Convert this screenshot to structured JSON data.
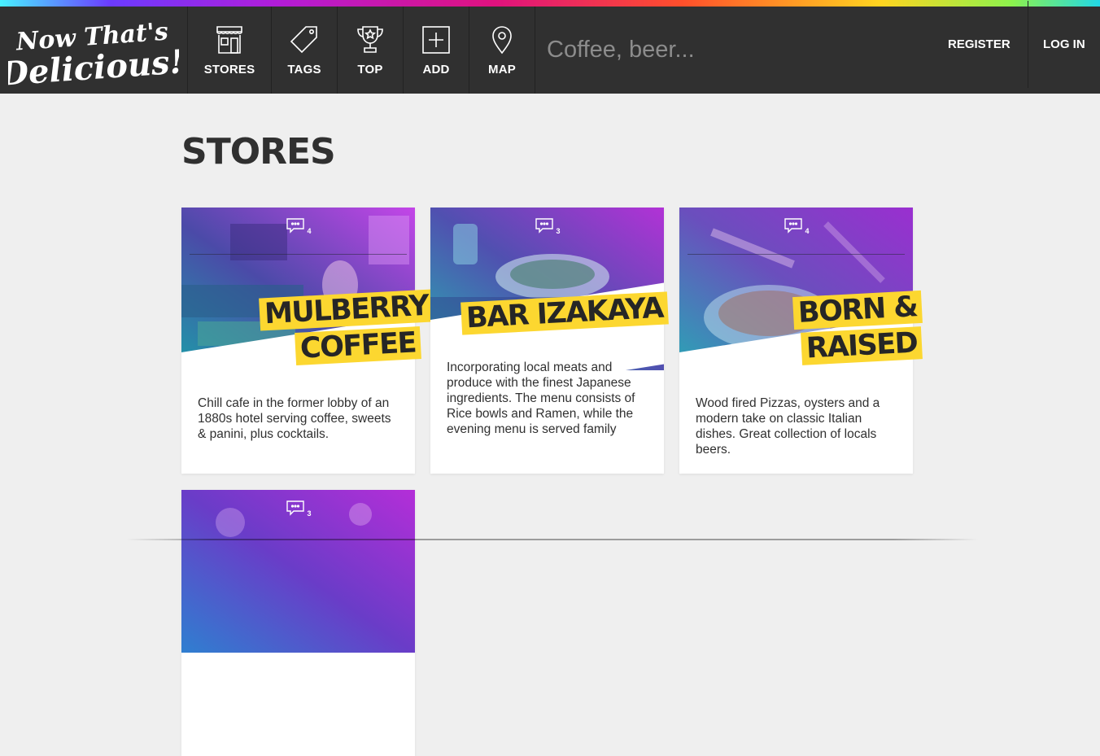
{
  "brand": {
    "logo_line1": "Now That's",
    "logo_line2": "Delicious!"
  },
  "nav": [
    {
      "label": "STORES",
      "icon": "store-icon"
    },
    {
      "label": "TAGS",
      "icon": "tag-icon"
    },
    {
      "label": "TOP",
      "icon": "trophy-icon"
    },
    {
      "label": "ADD",
      "icon": "add-icon"
    },
    {
      "label": "MAP",
      "icon": "map-pin-icon"
    }
  ],
  "search": {
    "placeholder": "Coffee, beer..."
  },
  "auth": {
    "register": "REGISTER",
    "login": "LOG IN"
  },
  "page": {
    "title": "STORES"
  },
  "stores": [
    {
      "title_lines": [
        "MULBERRY",
        "COFFEE"
      ],
      "comments": "4",
      "description": "Chill cafe in the former lobby of an 1880s hotel serving coffee, sweets & panini, plus cocktails."
    },
    {
      "title_lines": [
        "BAR IZAKAYA"
      ],
      "comments": "3",
      "description": "Incorporating local meats and produce with the finest Japanese ingredients. The menu consists of Rice bowls and Ramen, while the evening menu is served family"
    },
    {
      "title_lines": [
        "BORN &",
        "RAISED"
      ],
      "comments": "4",
      "description": "Wood fired Pizzas, oysters and a modern take on classic Italian dishes. Great collection of locals beers."
    },
    {
      "title_lines": [],
      "comments": "3",
      "description": ""
    }
  ],
  "colors": {
    "header_bg": "#303030",
    "page_bg": "#efefef",
    "title_highlight": "#fcd730"
  }
}
